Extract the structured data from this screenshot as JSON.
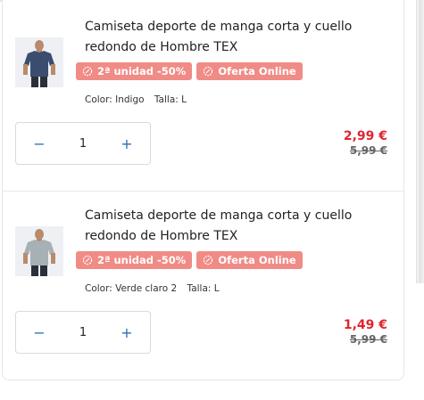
{
  "colors": {
    "badge_bg": "#f08b86",
    "price_now": "#e0242f",
    "stepper_accent": "#2d6fb4"
  },
  "cart": {
    "items": [
      {
        "title": "Camiseta deporte de manga corta y cuello redondo de Hombre TEX",
        "image_icon": "product-tshirt-indigo",
        "badges": [
          "2ª unidad -50%",
          "Oferta Online"
        ],
        "color": "Color: Indigo",
        "size": "Talla: L",
        "quantity": "1",
        "minus_label": "−",
        "plus_label": "+",
        "price": "2,99 €",
        "old_price": "5,99 €"
      },
      {
        "title": "Camiseta deporte de manga corta y cuello redondo de Hombre TEX",
        "image_icon": "product-tshirt-light-green",
        "badges": [
          "2ª unidad -50%",
          "Oferta Online"
        ],
        "color": "Color: Verde claro 2",
        "size": "Talla: L",
        "quantity": "1",
        "minus_label": "−",
        "plus_label": "+",
        "price": "1,49 €",
        "old_price": "5,99 €"
      }
    ]
  }
}
